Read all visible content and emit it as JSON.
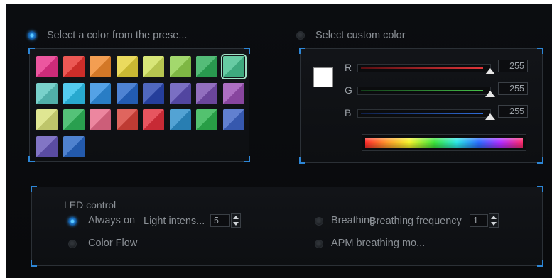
{
  "preset": {
    "radio_label": "Select a color from the prese...",
    "swatches": [
      {
        "color": "#e8318a"
      },
      {
        "color": "#e8332f"
      },
      {
        "color": "#f0892c"
      },
      {
        "color": "#e5d23a"
      },
      {
        "color": "#cfe05b"
      },
      {
        "color": "#8fd04d"
      },
      {
        "color": "#2fae5a"
      },
      {
        "color": "#46c08f",
        "selected": true
      },
      {
        "color": "#5cc7c0"
      },
      {
        "color": "#2ec0ec"
      },
      {
        "color": "#2f8ee0"
      },
      {
        "color": "#2768c9"
      },
      {
        "color": "#2a47b0"
      },
      {
        "color": "#5d4fb6"
      },
      {
        "color": "#7a4fb0"
      },
      {
        "color": "#9b4fb4"
      },
      {
        "color": "#d8e07a"
      },
      {
        "color": "#2fb55a"
      },
      {
        "color": "#e86b8a"
      },
      {
        "color": "#d8433a"
      },
      {
        "color": "#e2303c"
      },
      {
        "color": "#2d8fcb"
      },
      {
        "color": "#2db44f"
      },
      {
        "color": "#3e64c6"
      },
      {
        "color": "#6657b8"
      },
      {
        "color": "#2867c4"
      }
    ]
  },
  "custom": {
    "radio_label": "Select custom color",
    "preview_color": "#ffffff",
    "channels": [
      {
        "name": "R",
        "value": "255",
        "color": "#e0363a"
      },
      {
        "name": "G",
        "value": "255",
        "color": "#47c24a"
      },
      {
        "name": "B",
        "value": "255",
        "color": "#2f6cd8"
      }
    ]
  },
  "led": {
    "title": "LED control",
    "always_on": {
      "label": "Always on",
      "intensity_label": "Light intens...",
      "intensity_value": "5"
    },
    "breathing": {
      "label": "Breathing",
      "frequency_label": "Breathing frequency",
      "frequency_value": "1"
    },
    "color_flow": {
      "label": "Color Flow"
    },
    "apm": {
      "label": "APM breathing mo..."
    }
  },
  "colors": {
    "accent": "#2d86d6",
    "panel_border": "#2b3036",
    "background": "#0b0d10"
  }
}
